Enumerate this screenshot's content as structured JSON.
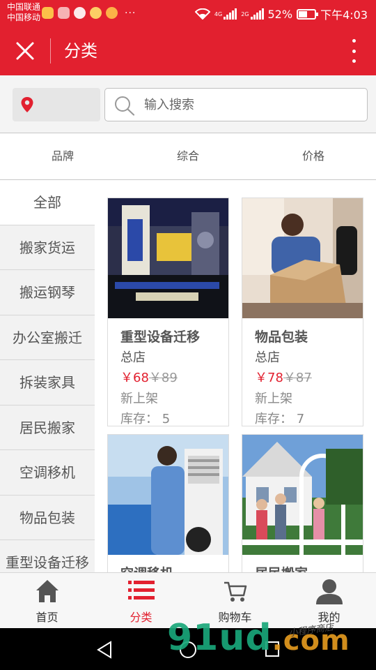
{
  "status_bar": {
    "carrier1": "中国联通",
    "carrier2": "中国移动",
    "dots": "···",
    "network1": "4G",
    "network2": "2G",
    "battery": "52%",
    "battery_level": 0.52,
    "time": "下午4:03"
  },
  "app_bar": {
    "title": "分类",
    "close_icon": "close-icon",
    "more_icon": "more-vertical-icon"
  },
  "search": {
    "location_icon": "location-pin-icon",
    "placeholder": "输入搜索",
    "value": ""
  },
  "sort_tabs": [
    "品牌",
    "综合",
    "价格"
  ],
  "categories": [
    "全部",
    "搬家货运",
    "搬运钢琴",
    "办公室搬迁",
    "拆装家具",
    "居民搬家",
    "空调移机",
    "物品包装",
    "重型设备迁移"
  ],
  "products": [
    {
      "name": "重型设备迁移",
      "store": "总店",
      "price": "￥68",
      "old_price": "￥89",
      "tag": "新上架",
      "stock": "库存： 5"
    },
    {
      "name": "物品包装",
      "store": "总店",
      "price": "￥78",
      "old_price": "￥87",
      "tag": "新上架",
      "stock": "库存： 7"
    },
    {
      "name": "空调移机",
      "store": "",
      "price": "",
      "old_price": "",
      "tag": "",
      "stock": ""
    },
    {
      "name": "居民搬家",
      "store": "",
      "price": "",
      "old_price": "",
      "tag": "",
      "stock": ""
    }
  ],
  "bottom_nav": [
    {
      "label": "首页",
      "icon": "home-icon"
    },
    {
      "label": "分类",
      "icon": "category-list-icon"
    },
    {
      "label": "购物车",
      "icon": "cart-icon"
    },
    {
      "label": "我的",
      "icon": "user-icon"
    }
  ],
  "watermark": {
    "text": "91ud",
    "suffix": ".com",
    "sub": "小程序商店"
  },
  "colors": {
    "brand": "#e2202f",
    "price": "#e2202f"
  }
}
